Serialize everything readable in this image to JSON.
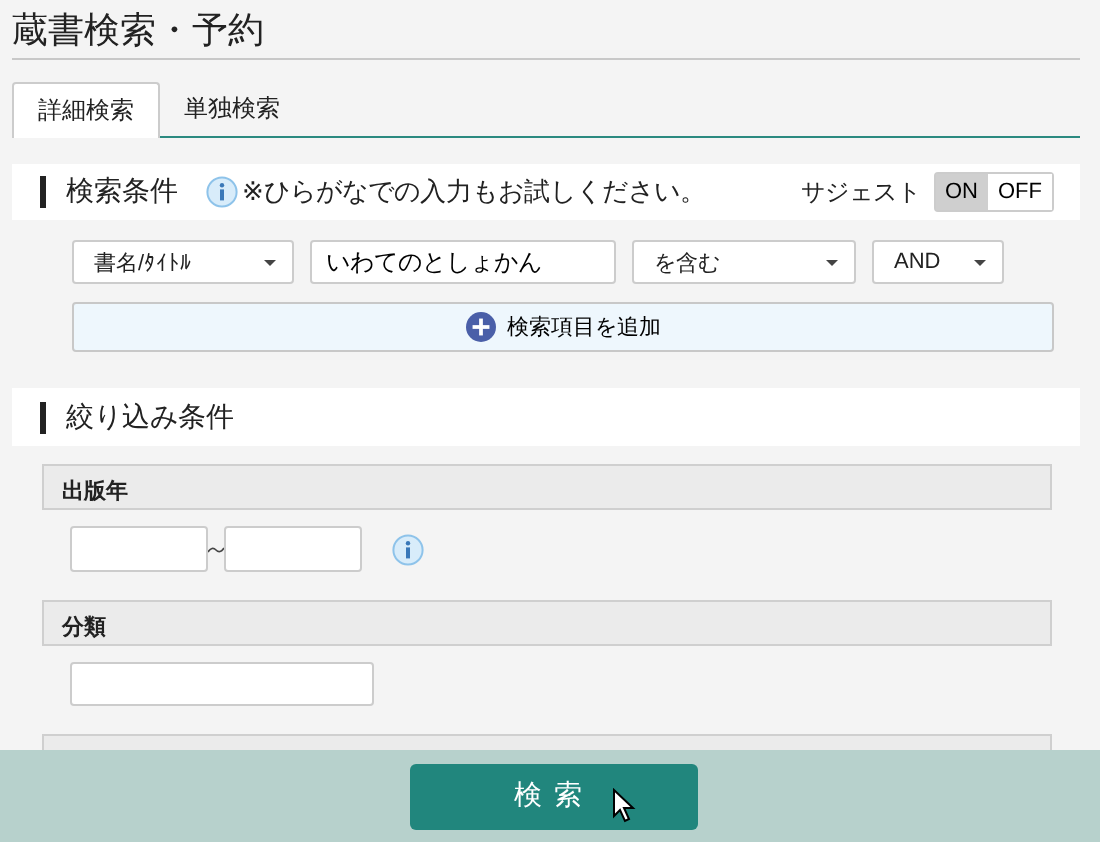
{
  "page_title": "蔵書検索・予約",
  "tabs": [
    {
      "label": "詳細検索",
      "selected": true
    },
    {
      "label": "単独検索",
      "selected": false
    }
  ],
  "search_conditions": {
    "heading": "検索条件",
    "note": "※ひらがなでの入力もお試しください。",
    "suggest": {
      "label": "サジェスト",
      "options": [
        {
          "label": "ON",
          "selected": true
        },
        {
          "label": "OFF",
          "selected": false
        }
      ]
    },
    "row": {
      "field": "書名/ﾀｲﾄﾙ",
      "keyword": "いわてのとしょかん",
      "match": "を含む",
      "operator": "AND"
    },
    "add_button": "検索項目を追加"
  },
  "filters": {
    "heading": "絞り込み条件",
    "groups": [
      {
        "label": "出版年",
        "kind": "range"
      },
      {
        "label": "分類",
        "kind": "text"
      }
    ]
  },
  "search_button": "検索"
}
